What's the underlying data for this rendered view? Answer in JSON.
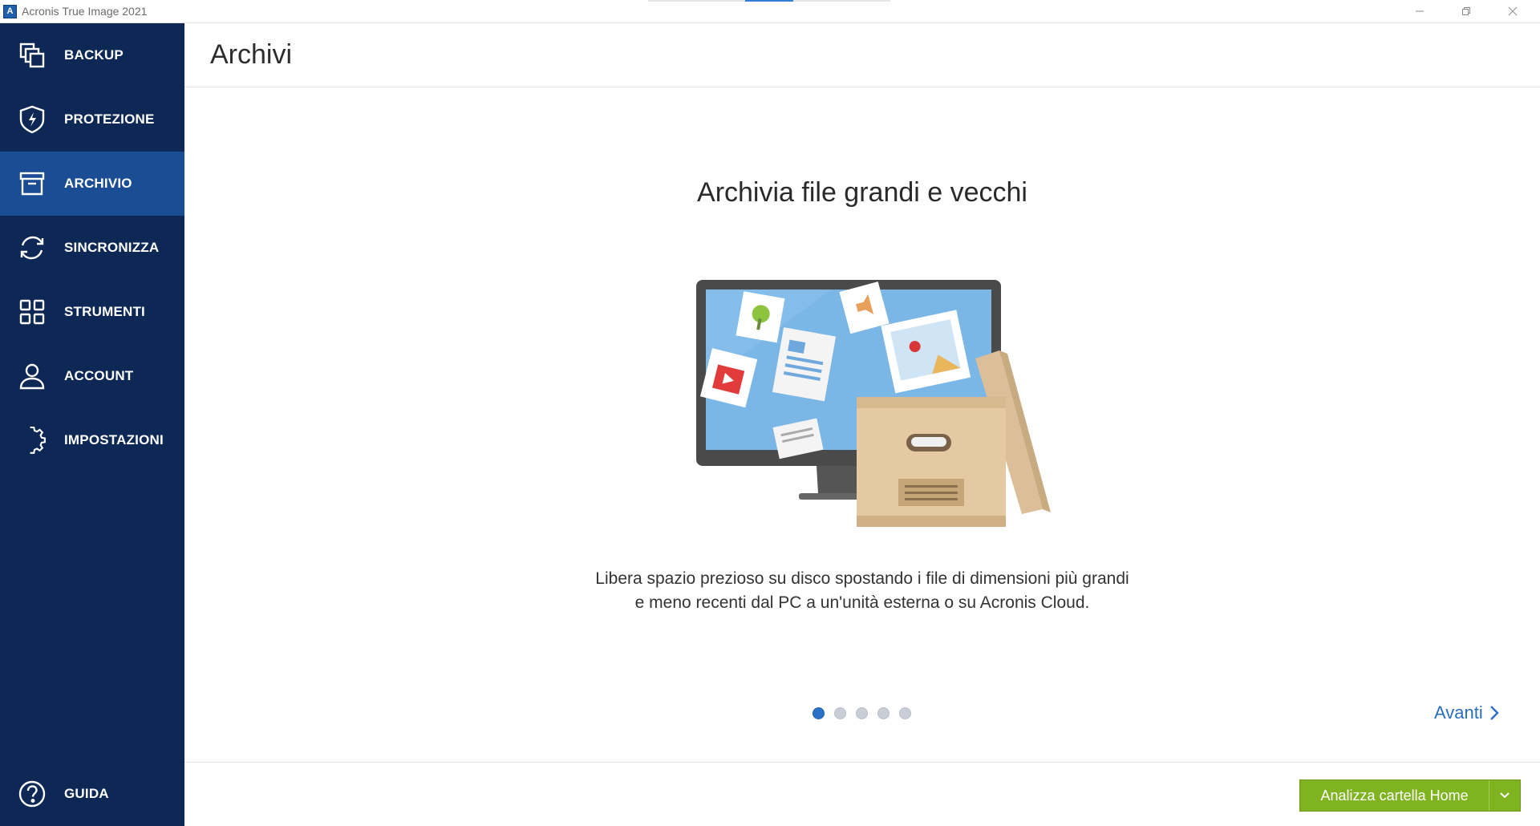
{
  "window": {
    "title": "Acronis True Image 2021",
    "app_icon_letter": "A"
  },
  "sidebar": {
    "items": [
      {
        "id": "backup",
        "label": "BACKUP",
        "icon": "backup-copies-icon",
        "active": false
      },
      {
        "id": "protezione",
        "label": "PROTEZIONE",
        "icon": "shield-bolt-icon",
        "active": false
      },
      {
        "id": "archivio",
        "label": "ARCHIVIO",
        "icon": "archive-box-icon",
        "active": true
      },
      {
        "id": "sincronizza",
        "label": "SINCRONIZZA",
        "icon": "sync-arrows-icon",
        "active": false
      },
      {
        "id": "strumenti",
        "label": "STRUMENTI",
        "icon": "grid-tools-icon",
        "active": false
      },
      {
        "id": "account",
        "label": "ACCOUNT",
        "icon": "user-icon",
        "active": false
      },
      {
        "id": "impostazioni",
        "label": "IMPOSTAZIONI",
        "icon": "gear-icon",
        "active": false
      }
    ],
    "help": {
      "label": "GUIDA",
      "icon": "help-circle-icon"
    }
  },
  "main": {
    "title": "Archivi",
    "slide": {
      "heading": "Archivia file grandi e vecchi",
      "description_line1": "Libera spazio prezioso su disco spostando i file di dimensioni più grandi",
      "description_line2": "e meno recenti dal PC a un'unità esterna o su Acronis Cloud.",
      "total_slides": 5,
      "current_slide": 1
    },
    "next_label": "Avanti",
    "primary_button": "Analizza cartella Home"
  },
  "colors": {
    "sidebar_bg": "#0d2855",
    "sidebar_active": "#1a4d93",
    "accent_blue": "#2a6fbf",
    "button_green": "#7fb320"
  }
}
